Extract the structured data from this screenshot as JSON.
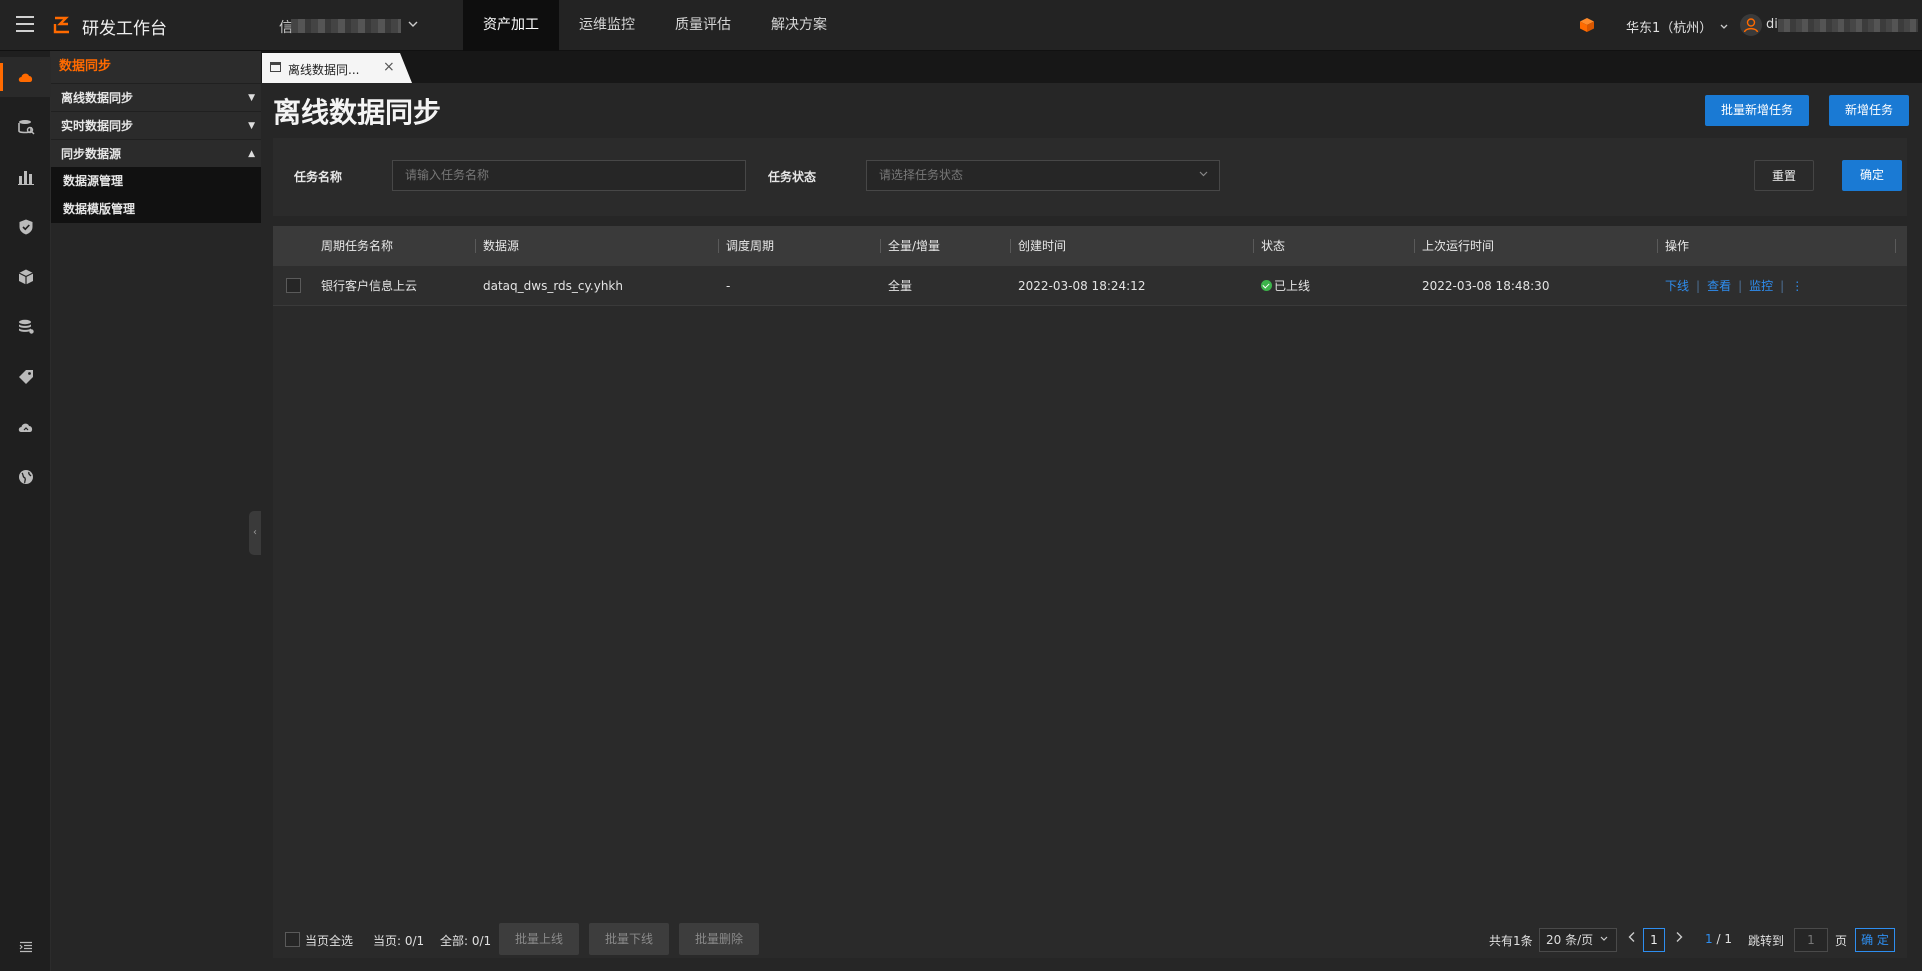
{
  "topbar": {
    "app_title": "研发工作台",
    "workspace_first_char": "信",
    "nav": [
      "资产加工",
      "运维监控",
      "质量评估",
      "解决方案"
    ],
    "active_nav": "资产加工",
    "region": "华东1（杭州）",
    "user_prefix": "di"
  },
  "sidebar": {
    "section": "数据同步",
    "groups": [
      {
        "label": "离线数据同步",
        "arrow": "▼"
      },
      {
        "label": "实时数据同步",
        "arrow": "▼"
      },
      {
        "label": "同步数据源",
        "arrow": "▲"
      }
    ],
    "subitems": [
      "数据源管理",
      "数据模版管理"
    ]
  },
  "tab": {
    "label": "离线数据同..."
  },
  "page": {
    "title": "离线数据同步",
    "batch_add_label": "批量新增任务",
    "add_label": "新增任务"
  },
  "filter": {
    "name_label": "任务名称",
    "name_placeholder": "请输入任务名称",
    "status_label": "任务状态",
    "status_placeholder": "请选择任务状态",
    "reset_label": "重置",
    "confirm_label": "确定"
  },
  "table": {
    "columns": [
      "周期任务名称",
      "数据源",
      "调度周期",
      "全量/增量",
      "创建时间",
      "状态",
      "上次运行时间",
      "操作"
    ],
    "rows": [
      {
        "name": "银行客户信息上云",
        "source": "dataq_dws_rds_cy.yhkh",
        "schedule": "-",
        "mode": "全量",
        "created": "2022-03-08 18:24:12",
        "status": "已上线",
        "last_run": "2022-03-08 18:48:30",
        "actions": [
          "下线",
          "查看",
          "监控",
          "⋮"
        ]
      }
    ]
  },
  "footer": {
    "select_all": "当页全选",
    "page_count": "当页: 0/1",
    "total_count": "全部: 0/1",
    "batch_online": "批量上线",
    "batch_offline": "批量下线",
    "batch_delete": "批量删除",
    "total_text": "共有1条",
    "page_size": "20 条/页",
    "current_page": "1",
    "page_indicator_current": "1",
    "page_indicator_total": "/ 1",
    "jump_label": "跳转到",
    "jump_value": "1",
    "page_unit": "页",
    "jump_confirm": "确 定"
  },
  "colors": {
    "accent": "#ff6a00",
    "primary": "#1a7ad4",
    "link": "#2e8ef0",
    "success": "#3cb34a"
  }
}
